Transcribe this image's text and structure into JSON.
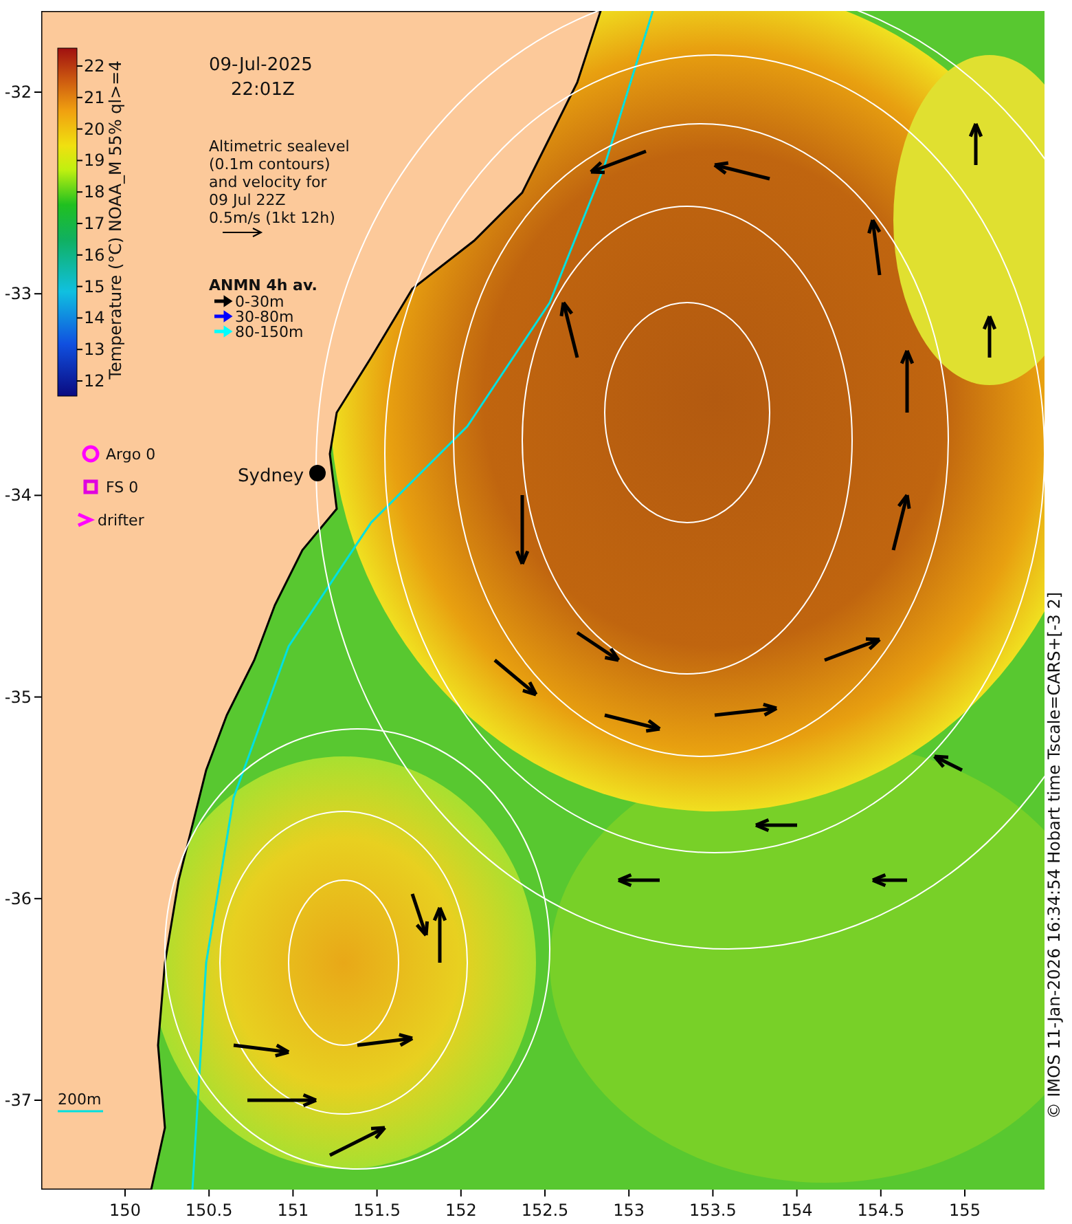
{
  "date": "09-Jul-2025",
  "time": "22:01Z",
  "sealevel_note": [
    "Altimetric sealevel",
    "(0.1m contours)",
    "and velocity for",
    "09 Jul 22Z",
    "0.5m/s (1kt 12h)"
  ],
  "anmn_legend": {
    "title": "ANMN 4h av.",
    "items": [
      {
        "label": "0-30m",
        "color": "#000000"
      },
      {
        "label": "30-80m",
        "color": "#0000ff"
      },
      {
        "label": "80-150m",
        "color": "#00ffff"
      }
    ]
  },
  "markers": [
    {
      "kind": "argo",
      "label": "Argo 0"
    },
    {
      "kind": "fs",
      "label": "FS 0"
    },
    {
      "kind": "drifter",
      "label": "drifter"
    }
  ],
  "place_label": "Sydney",
  "depth_label": "200m",
  "colorbar": {
    "label": "Temperature (°C) NOAA_M 55% ql>=4",
    "ticks": [
      "22",
      "21",
      "20",
      "19",
      "18",
      "17",
      "16",
      "15",
      "14",
      "13",
      "12"
    ]
  },
  "x_ticks": [
    "150",
    "150.5",
    "151",
    "151.5",
    "152",
    "152.5",
    "153",
    "153.5",
    "154",
    "154.5",
    "155"
  ],
  "y_ticks": [
    "-32",
    "-33",
    "-34",
    "-35",
    "-36",
    "-37"
  ],
  "credit": "© IMOS 11-Jan-2026 16:34:54 Hobart time Tscale=CARS+[-3 2]"
}
